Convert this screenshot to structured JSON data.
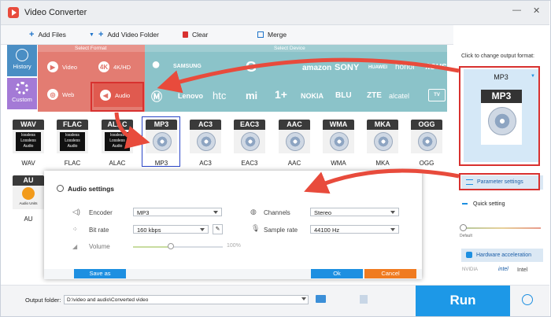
{
  "window": {
    "title": "Video Converter",
    "minimize": "—",
    "close": "✕"
  },
  "toolbar": {
    "add_files": "Add Files",
    "add_video_folder": "Add Video Folder",
    "clear": "Clear",
    "merge": "Merge"
  },
  "sidebar": {
    "history": "History",
    "custom": "Custom"
  },
  "format_panel": {
    "select_format": "Select Format",
    "select_device": "Select Device",
    "categories": {
      "video": "Video",
      "hd": "4K/HD",
      "web": "Web",
      "audio": "Audio"
    },
    "devices_row1": [
      "SAMSUNG",
      "G",
      "amazon",
      "SONY",
      "HUAWEI",
      "honor",
      "/ISUS"
    ],
    "devices_row2": [
      "Lenovo",
      "htc",
      "mi",
      "1+",
      "NOKIA",
      "BLU",
      "ZTE",
      "alcatel",
      "TV"
    ]
  },
  "formats": [
    {
      "name": "WAV",
      "label": "WAV",
      "lossless": true
    },
    {
      "name": "FLAC",
      "label": "FLAC",
      "lossless": true
    },
    {
      "name": "ALAC",
      "label": "ALAC",
      "lossless": true
    },
    {
      "name": "MP3",
      "label": "MP3",
      "lossless": false
    },
    {
      "name": "AC3",
      "label": "AC3",
      "lossless": false
    },
    {
      "name": "EAC3",
      "label": "EAC3",
      "lossless": false
    },
    {
      "name": "AAC",
      "label": "AAC",
      "lossless": false
    },
    {
      "name": "WMA",
      "label": "WMA",
      "lossless": false
    },
    {
      "name": "MKA",
      "label": "MKA",
      "lossless": false
    },
    {
      "name": "OGG",
      "label": "OGG",
      "lossless": false
    }
  ],
  "lossless_text": "lossless\nLossless\nAudio",
  "au_tile": {
    "name": "AU",
    "sub": "Audio Units",
    "label": "AU"
  },
  "audio_settings": {
    "title": "Audio settings",
    "encoder_label": "Encoder",
    "encoder_value": "MP3",
    "bitrate_label": "Bit rate",
    "bitrate_value": "160 kbps",
    "volume_label": "Volume",
    "volume_value": "100%",
    "volume_level": 0.42,
    "channels_label": "Channels",
    "channels_value": "Stereo",
    "samplerate_label": "Sample rate",
    "samplerate_value": "44100 Hz",
    "save_as": "Save as",
    "ok": "Ok",
    "cancel": "Cancel"
  },
  "right_panel": {
    "hint": "Click to change output format:",
    "format_name": "MP3",
    "format_badge": "MP3",
    "parameter_settings": "Parameter settings",
    "quick_setting": "Quick setting",
    "default": "Default",
    "hardware_acceleration": "Hardware acceleration",
    "nvidia": "NVIDIA",
    "intel": "intel",
    "intel2": "Intel"
  },
  "bottom": {
    "output_folder_label": "Output folder:",
    "output_folder_value": "D:\\video and audio\\Converted video",
    "run": "Run"
  },
  "colors": {
    "accent_red": "#d8312f",
    "salmon": "#e37c72",
    "teal": "#8bc3c9",
    "blue": "#1d8fe1",
    "orange": "#f07b20",
    "purple": "#a47ad6"
  }
}
